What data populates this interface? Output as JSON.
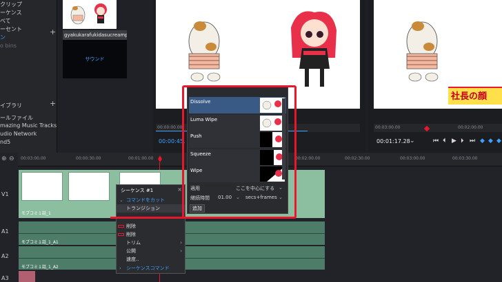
{
  "left_panel": {
    "items": [
      "クリップ",
      "ーケンス",
      "べて",
      "ーセント",
      "ン",
      "o bins"
    ],
    "library_header": "イブラリ",
    "library_items": [
      "ールファイル",
      "mazing Music Tracks",
      "udio Network",
      "nd5"
    ]
  },
  "media": {
    "filename": "gyakukarafukidasucreampu",
    "sound_label": "サウンド"
  },
  "source_viewer": {
    "timecode": "00:00:45.",
    "ruler_ticks": [
      "00:00:00.00"
    ]
  },
  "program_viewer": {
    "timecode": "00:01:17.28",
    "ruler_ticks": [
      "00:03:00.00",
      "00:02:00.00",
      "00:03:00.00"
    ],
    "banner_text": "社長の顔"
  },
  "timeline": {
    "ruler_ticks": [
      "00:03:00.00",
      "00:00:30.00",
      "00:01:00.00",
      "00:02:00.00",
      "00:02:30.00",
      "00:03:00.00",
      "00:03:30.00",
      "00:04:00.00",
      "00:04:30.00"
    ],
    "tracks": [
      "V1",
      "A1",
      "A2",
      "A3"
    ],
    "video_clip_name": "モブコミ１話_1",
    "audio1_clip_name": "モブコミ１話_1_A1",
    "audio2_clip_name": "モブコミ１話_1_A2"
  },
  "context_menu": {
    "title": "シーケンス #1",
    "items": [
      {
        "label": "コマンドをカット",
        "blue": true
      },
      {
        "label": "トランジション",
        "blue": false
      },
      {
        "label": "",
        "blue": false
      },
      {
        "label": "削除",
        "blue": false
      },
      {
        "label": "削除",
        "blue": false
      },
      {
        "label": "トリム",
        "blue": false
      },
      {
        "label": "公開",
        "blue": false
      },
      {
        "label": "速度..",
        "blue": false
      },
      {
        "label": "シーケンスコマンド",
        "blue": true
      }
    ]
  },
  "transitions": {
    "items": [
      "Dissolve",
      "Luma Wipe",
      "Push",
      "Squeeze",
      "Wipe"
    ],
    "apply_label": "適用",
    "apply_value": "ここを中心にする",
    "duration_label": "継続時間",
    "duration_value": "01.00",
    "duration_unit": "secs+frames",
    "add_label": "追加"
  },
  "colors": {
    "accent": "#3fa0ff",
    "highlight": "#e8172e",
    "clip": "#8cbfa0"
  }
}
